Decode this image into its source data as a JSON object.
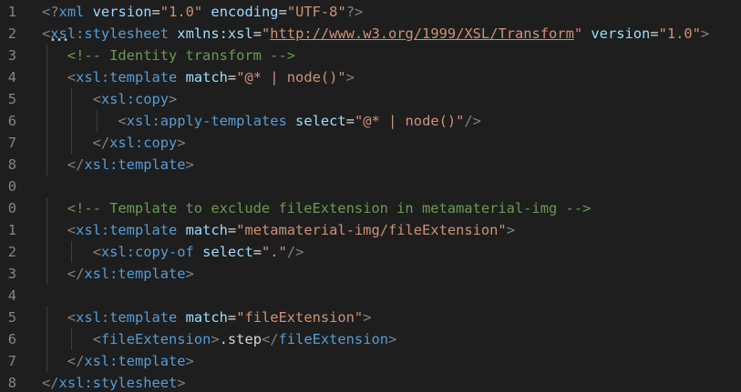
{
  "editor": {
    "lines": [
      {
        "number": "1",
        "indent": 0,
        "tokens": [
          {
            "type": "punct",
            "text": "<?"
          },
          {
            "type": "tag",
            "text": "xml"
          },
          {
            "type": "text",
            "text": " "
          },
          {
            "type": "attr",
            "text": "version"
          },
          {
            "type": "eq",
            "text": "="
          },
          {
            "type": "str",
            "text": "\"1.0\""
          },
          {
            "type": "text",
            "text": " "
          },
          {
            "type": "attr",
            "text": "encoding"
          },
          {
            "type": "eq",
            "text": "="
          },
          {
            "type": "str",
            "text": "\"UTF-8\""
          },
          {
            "type": "punct",
            "text": "?>"
          }
        ]
      },
      {
        "number": "2",
        "indent": 0,
        "tokens": [
          {
            "type": "punct",
            "text": "<"
          },
          {
            "type": "tag",
            "text": "xsl:stylesheet"
          },
          {
            "type": "text",
            "text": " "
          },
          {
            "type": "attr",
            "text": "xmlns:xsl"
          },
          {
            "type": "eq",
            "text": "="
          },
          {
            "type": "str",
            "text": "\""
          },
          {
            "type": "link",
            "text": "http://www.w3.org/1999/XSL/Transform"
          },
          {
            "type": "str",
            "text": "\""
          },
          {
            "type": "text",
            "text": " "
          },
          {
            "type": "attr",
            "text": "version"
          },
          {
            "type": "eq",
            "text": "="
          },
          {
            "type": "str",
            "text": "\"1.0\""
          },
          {
            "type": "punct",
            "text": ">"
          }
        ]
      },
      {
        "number": "3",
        "indent": 1,
        "tokens": [
          {
            "type": "comment",
            "text": "<!-- Identity transform -->"
          }
        ]
      },
      {
        "number": "4",
        "indent": 1,
        "tokens": [
          {
            "type": "punct",
            "text": "<"
          },
          {
            "type": "tag",
            "text": "xsl:template"
          },
          {
            "type": "text",
            "text": " "
          },
          {
            "type": "attr",
            "text": "match"
          },
          {
            "type": "eq",
            "text": "="
          },
          {
            "type": "str",
            "text": "\"@* | node()\""
          },
          {
            "type": "punct",
            "text": ">"
          }
        ]
      },
      {
        "number": "5",
        "indent": 2,
        "tokens": [
          {
            "type": "punct",
            "text": "<"
          },
          {
            "type": "tag",
            "text": "xsl:copy"
          },
          {
            "type": "punct",
            "text": ">"
          }
        ]
      },
      {
        "number": "6",
        "indent": 3,
        "tokens": [
          {
            "type": "punct",
            "text": "<"
          },
          {
            "type": "tag",
            "text": "xsl:apply-templates"
          },
          {
            "type": "text",
            "text": " "
          },
          {
            "type": "attr",
            "text": "select"
          },
          {
            "type": "eq",
            "text": "="
          },
          {
            "type": "str",
            "text": "\"@* | node()\""
          },
          {
            "type": "punct",
            "text": "/>"
          }
        ]
      },
      {
        "number": "7",
        "indent": 2,
        "tokens": [
          {
            "type": "punct",
            "text": "</"
          },
          {
            "type": "tag",
            "text": "xsl:copy"
          },
          {
            "type": "punct",
            "text": ">"
          }
        ]
      },
      {
        "number": "8",
        "indent": 1,
        "tokens": [
          {
            "type": "punct",
            "text": "</"
          },
          {
            "type": "tag",
            "text": "xsl:template"
          },
          {
            "type": "punct",
            "text": ">"
          }
        ]
      },
      {
        "number": "0",
        "indent": 0,
        "tokens": []
      },
      {
        "number": "0",
        "indent": 1,
        "tokens": [
          {
            "type": "comment",
            "text": "<!-- Template to exclude fileExtension in metamaterial-img -->"
          }
        ]
      },
      {
        "number": "1",
        "indent": 1,
        "tokens": [
          {
            "type": "punct",
            "text": "<"
          },
          {
            "type": "tag",
            "text": "xsl:template"
          },
          {
            "type": "text",
            "text": " "
          },
          {
            "type": "attr",
            "text": "match"
          },
          {
            "type": "eq",
            "text": "="
          },
          {
            "type": "str",
            "text": "\"metamaterial-img/fileExtension\""
          },
          {
            "type": "punct",
            "text": ">"
          }
        ]
      },
      {
        "number": "2",
        "indent": 2,
        "tokens": [
          {
            "type": "punct",
            "text": "<"
          },
          {
            "type": "tag",
            "text": "xsl:copy-of"
          },
          {
            "type": "text",
            "text": " "
          },
          {
            "type": "attr",
            "text": "select"
          },
          {
            "type": "eq",
            "text": "="
          },
          {
            "type": "str",
            "text": "\".\""
          },
          {
            "type": "punct",
            "text": "/>"
          }
        ]
      },
      {
        "number": "3",
        "indent": 1,
        "tokens": [
          {
            "type": "punct",
            "text": "</"
          },
          {
            "type": "tag",
            "text": "xsl:template"
          },
          {
            "type": "punct",
            "text": ">"
          }
        ]
      },
      {
        "number": "4",
        "indent": 0,
        "tokens": []
      },
      {
        "number": "5",
        "indent": 1,
        "tokens": [
          {
            "type": "punct",
            "text": "<"
          },
          {
            "type": "tag",
            "text": "xsl:template"
          },
          {
            "type": "text",
            "text": " "
          },
          {
            "type": "attr",
            "text": "match"
          },
          {
            "type": "eq",
            "text": "="
          },
          {
            "type": "str",
            "text": "\"fileExtension\""
          },
          {
            "type": "punct",
            "text": ">"
          }
        ]
      },
      {
        "number": "6",
        "indent": 2,
        "tokens": [
          {
            "type": "punct",
            "text": "<"
          },
          {
            "type": "tag",
            "text": "fileExtension"
          },
          {
            "type": "punct",
            "text": ">"
          },
          {
            "type": "text",
            "text": ".step"
          },
          {
            "type": "punct",
            "text": "</"
          },
          {
            "type": "tag",
            "text": "fileExtension"
          },
          {
            "type": "punct",
            "text": ">"
          }
        ]
      },
      {
        "number": "7",
        "indent": 1,
        "tokens": [
          {
            "type": "punct",
            "text": "</"
          },
          {
            "type": "tag",
            "text": "xsl:template"
          },
          {
            "type": "punct",
            "text": ">"
          }
        ]
      },
      {
        "number": "8",
        "indent": 0,
        "tokens": [
          {
            "type": "punct",
            "text": "</"
          },
          {
            "type": "tag",
            "text": "xsl:stylesheet"
          },
          {
            "type": "punct",
            "text": ">"
          }
        ]
      }
    ],
    "ellipsis": "•••",
    "colors": {
      "background": "#1e1e1e",
      "line_number": "#858585",
      "punctuation": "#808080",
      "tag": "#569cd6",
      "attribute": "#9cdcfe",
      "string": "#ce9178",
      "comment": "#6a9955",
      "text": "#d4d4d4",
      "indent_guide": "#404040"
    }
  }
}
